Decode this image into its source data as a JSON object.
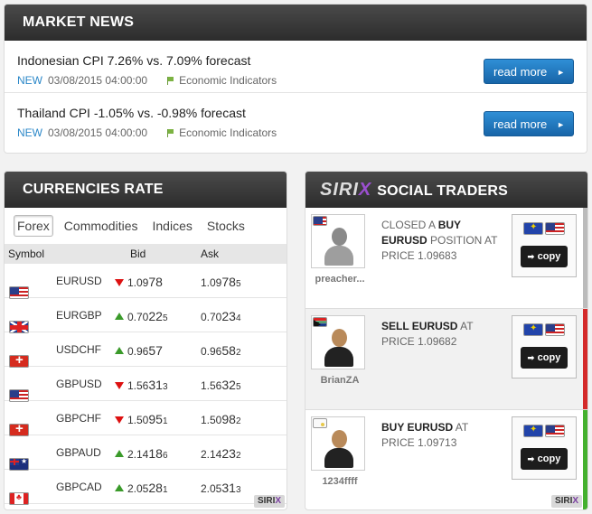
{
  "news": {
    "title": "MARKET NEWS",
    "items": [
      {
        "headline": "Indonesian CPI 7.26% vs. 7.09% forecast",
        "tag": "NEW",
        "date": "03/08/2015 04:00:00",
        "category": "Economic Indicators",
        "button": "read more"
      },
      {
        "headline": "Thailand CPI -1.05% vs. -0.98% forecast",
        "tag": "NEW",
        "date": "03/08/2015 04:00:00",
        "category": "Economic Indicators",
        "button": "read more"
      }
    ]
  },
  "rates": {
    "title": "CURRENCIES RATE",
    "tabs": [
      "Forex",
      "Commodities",
      "Indices",
      "Stocks"
    ],
    "columns": {
      "symbol": "Symbol",
      "bid": "Bid",
      "ask": "Ask"
    },
    "rows": [
      {
        "symbol": "EURUSD",
        "flags": [
          "eu",
          "us"
        ],
        "dir": "down",
        "bid": [
          "1.09",
          "78",
          ""
        ],
        "ask": [
          "1.09",
          "78",
          "5"
        ]
      },
      {
        "symbol": "EURGBP",
        "flags": [
          "eu",
          "gb"
        ],
        "dir": "up",
        "bid": [
          "0.70",
          "22",
          "5"
        ],
        "ask": [
          "0.70",
          "23",
          "4"
        ]
      },
      {
        "symbol": "USDCHF",
        "flags": [
          "us",
          "ch"
        ],
        "dir": "up",
        "bid": [
          "0.96",
          "57",
          ""
        ],
        "ask": [
          "0.96",
          "58",
          "2"
        ]
      },
      {
        "symbol": "GBPUSD",
        "flags": [
          "gb",
          "us"
        ],
        "dir": "down",
        "bid": [
          "1.56",
          "31",
          "3"
        ],
        "ask": [
          "1.56",
          "32",
          "5"
        ]
      },
      {
        "symbol": "GBPCHF",
        "flags": [
          "gb",
          "ch"
        ],
        "dir": "down",
        "bid": [
          "1.50",
          "95",
          "1"
        ],
        "ask": [
          "1.50",
          "98",
          "2"
        ]
      },
      {
        "symbol": "GBPAUD",
        "flags": [
          "gb",
          "au"
        ],
        "dir": "up",
        "bid": [
          "2.14",
          "18",
          "6"
        ],
        "ask": [
          "2.14",
          "23",
          "2"
        ]
      },
      {
        "symbol": "GBPCAD",
        "flags": [
          "gb",
          "ca"
        ],
        "dir": "up",
        "bid": [
          "2.05",
          "28",
          "1"
        ],
        "ask": [
          "2.05",
          "31",
          "3"
        ]
      }
    ],
    "badge": {
      "a": "SIRI",
      "b": "X"
    }
  },
  "social": {
    "logo": {
      "a": "SIRI",
      "b": "X"
    },
    "title": "SOCIAL TRADERS",
    "copy_label": "copy",
    "traders": [
      {
        "name": "preacher...",
        "flag": "us",
        "avatar": "grey",
        "bar": "#bbbbbb",
        "alt": false,
        "line1_pre": "CLOSED A ",
        "line1_bold": "BUY",
        "line2_bold": "EURUSD",
        "line2_post": " POSITION AT",
        "line3": "PRICE 1.09683"
      },
      {
        "name": "BrianZA",
        "flag": "za",
        "avatar": "tan",
        "bar": "#d42a2a",
        "alt": true,
        "line1_pre": "",
        "line1_bold": "SELL EURUSD",
        "line2_bold": "",
        "line2_post": " AT",
        "line3": "PRICE 1.09682"
      },
      {
        "name": "1234ffff",
        "flag": "xx",
        "avatar": "tan",
        "bar": "#44b02e",
        "alt": false,
        "line1_pre": "",
        "line1_bold": "BUY EURUSD",
        "line2_bold": "",
        "line2_post": " AT",
        "line3": "PRICE 1.09713"
      }
    ],
    "badge": {
      "a": "SIRI",
      "b": "X"
    }
  }
}
